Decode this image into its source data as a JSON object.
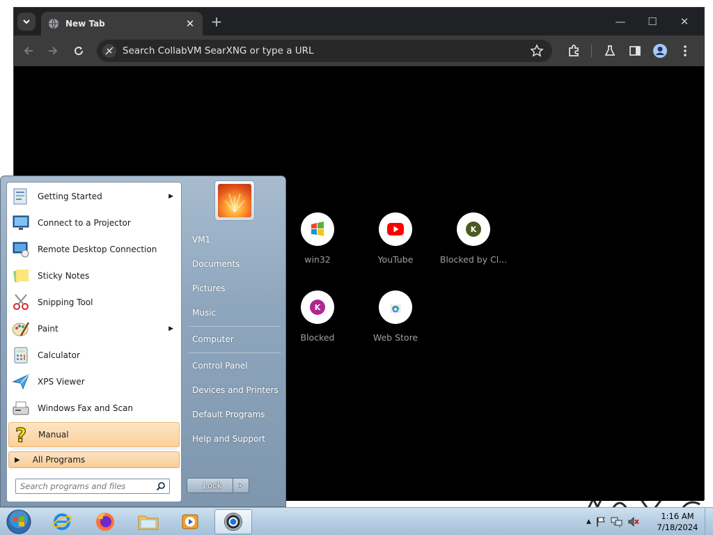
{
  "browser": {
    "tab_title": "New Tab",
    "omnibox_placeholder": "Search CollabVM SearXNG or type a URL",
    "shortcuts": [
      {
        "label": "win32",
        "icon": "windows-logo-icon"
      },
      {
        "label": "YouTube",
        "icon": "youtube-icon"
      },
      {
        "label": "Blocked by Cl...",
        "icon": "k-avatar-icon",
        "letter": "K",
        "color": "#4a5a23"
      },
      {
        "label": "Blocked",
        "icon": "k-avatar-icon",
        "letter": "K",
        "color": "#b0278f"
      },
      {
        "label": "Web Store",
        "icon": "web-store-icon"
      }
    ]
  },
  "start_menu": {
    "programs": [
      {
        "label": "Getting Started",
        "icon": "getting-started-icon",
        "submenu": true
      },
      {
        "label": "Connect to a Projector",
        "icon": "projector-icon",
        "submenu": false
      },
      {
        "label": "Remote Desktop Connection",
        "icon": "remote-desktop-icon",
        "submenu": false
      },
      {
        "label": "Sticky Notes",
        "icon": "sticky-notes-icon",
        "submenu": false
      },
      {
        "label": "Snipping Tool",
        "icon": "snipping-tool-icon",
        "submenu": false
      },
      {
        "label": "Paint",
        "icon": "paint-icon",
        "submenu": true
      },
      {
        "label": "Calculator",
        "icon": "calculator-icon",
        "submenu": false
      },
      {
        "label": "XPS Viewer",
        "icon": "xps-viewer-icon",
        "submenu": false
      },
      {
        "label": "Windows Fax and Scan",
        "icon": "fax-scan-icon",
        "submenu": false
      },
      {
        "label": "Manual",
        "icon": "help-question-icon",
        "submenu": false,
        "highlighted": true
      }
    ],
    "all_programs": "All Programs",
    "search_placeholder": "Search programs and files",
    "right_items": [
      "VM1",
      "Documents",
      "Pictures",
      "Music",
      "Computer",
      "Control Panel",
      "Devices and Printers",
      "Default Programs",
      "Help and Support"
    ],
    "lock_label": "Lock"
  },
  "taskbar": {
    "apps": [
      "internet-explorer-icon",
      "firefox-icon",
      "file-explorer-icon",
      "media-player-icon",
      "chrome-icon"
    ],
    "clock_time": "1:16 AM",
    "clock_date": "7/18/2024"
  }
}
